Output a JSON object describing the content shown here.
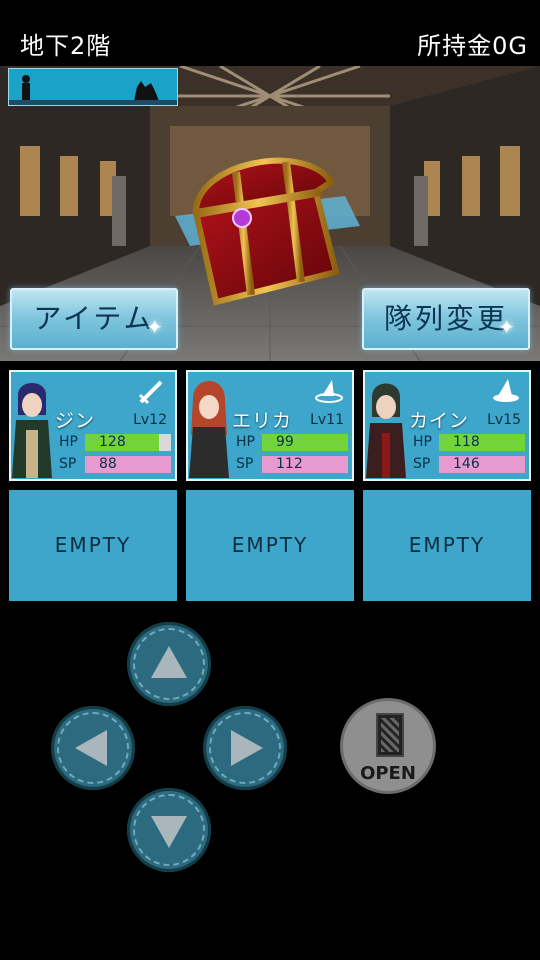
{
  "header": {
    "floor_label": "地下2階",
    "gold_label": "所持金0G"
  },
  "actions": {
    "item_label": "アイテム",
    "formation_label": "隊列変更"
  },
  "party": [
    {
      "name": "ジン",
      "level": "Lv12",
      "class_icon": "sword-icon",
      "hp": "128",
      "sp": "88",
      "hp_fraction": 0.86,
      "sp_fraction": 1.0
    },
    {
      "name": "エリカ",
      "level": "Lv11",
      "class_icon": "wizard-hat-icon",
      "hp": "99",
      "sp": "112",
      "hp_fraction": 1.0,
      "sp_fraction": 1.0
    },
    {
      "name": "カイン",
      "level": "Lv15",
      "class_icon": "wizard-hat-icon",
      "hp": "118",
      "sp": "146",
      "hp_fraction": 1.0,
      "sp_fraction": 1.0
    }
  ],
  "stat_labels": {
    "hp": "HP",
    "sp": "SP"
  },
  "empty_slots": [
    "EMPTY",
    "EMPTY",
    "EMPTY"
  ],
  "controls": {
    "open_label": "OPEN"
  },
  "colors": {
    "card_bg": "#3ea6cb",
    "hp_bar": "#73d33a",
    "sp_bar": "#e79ad0"
  }
}
